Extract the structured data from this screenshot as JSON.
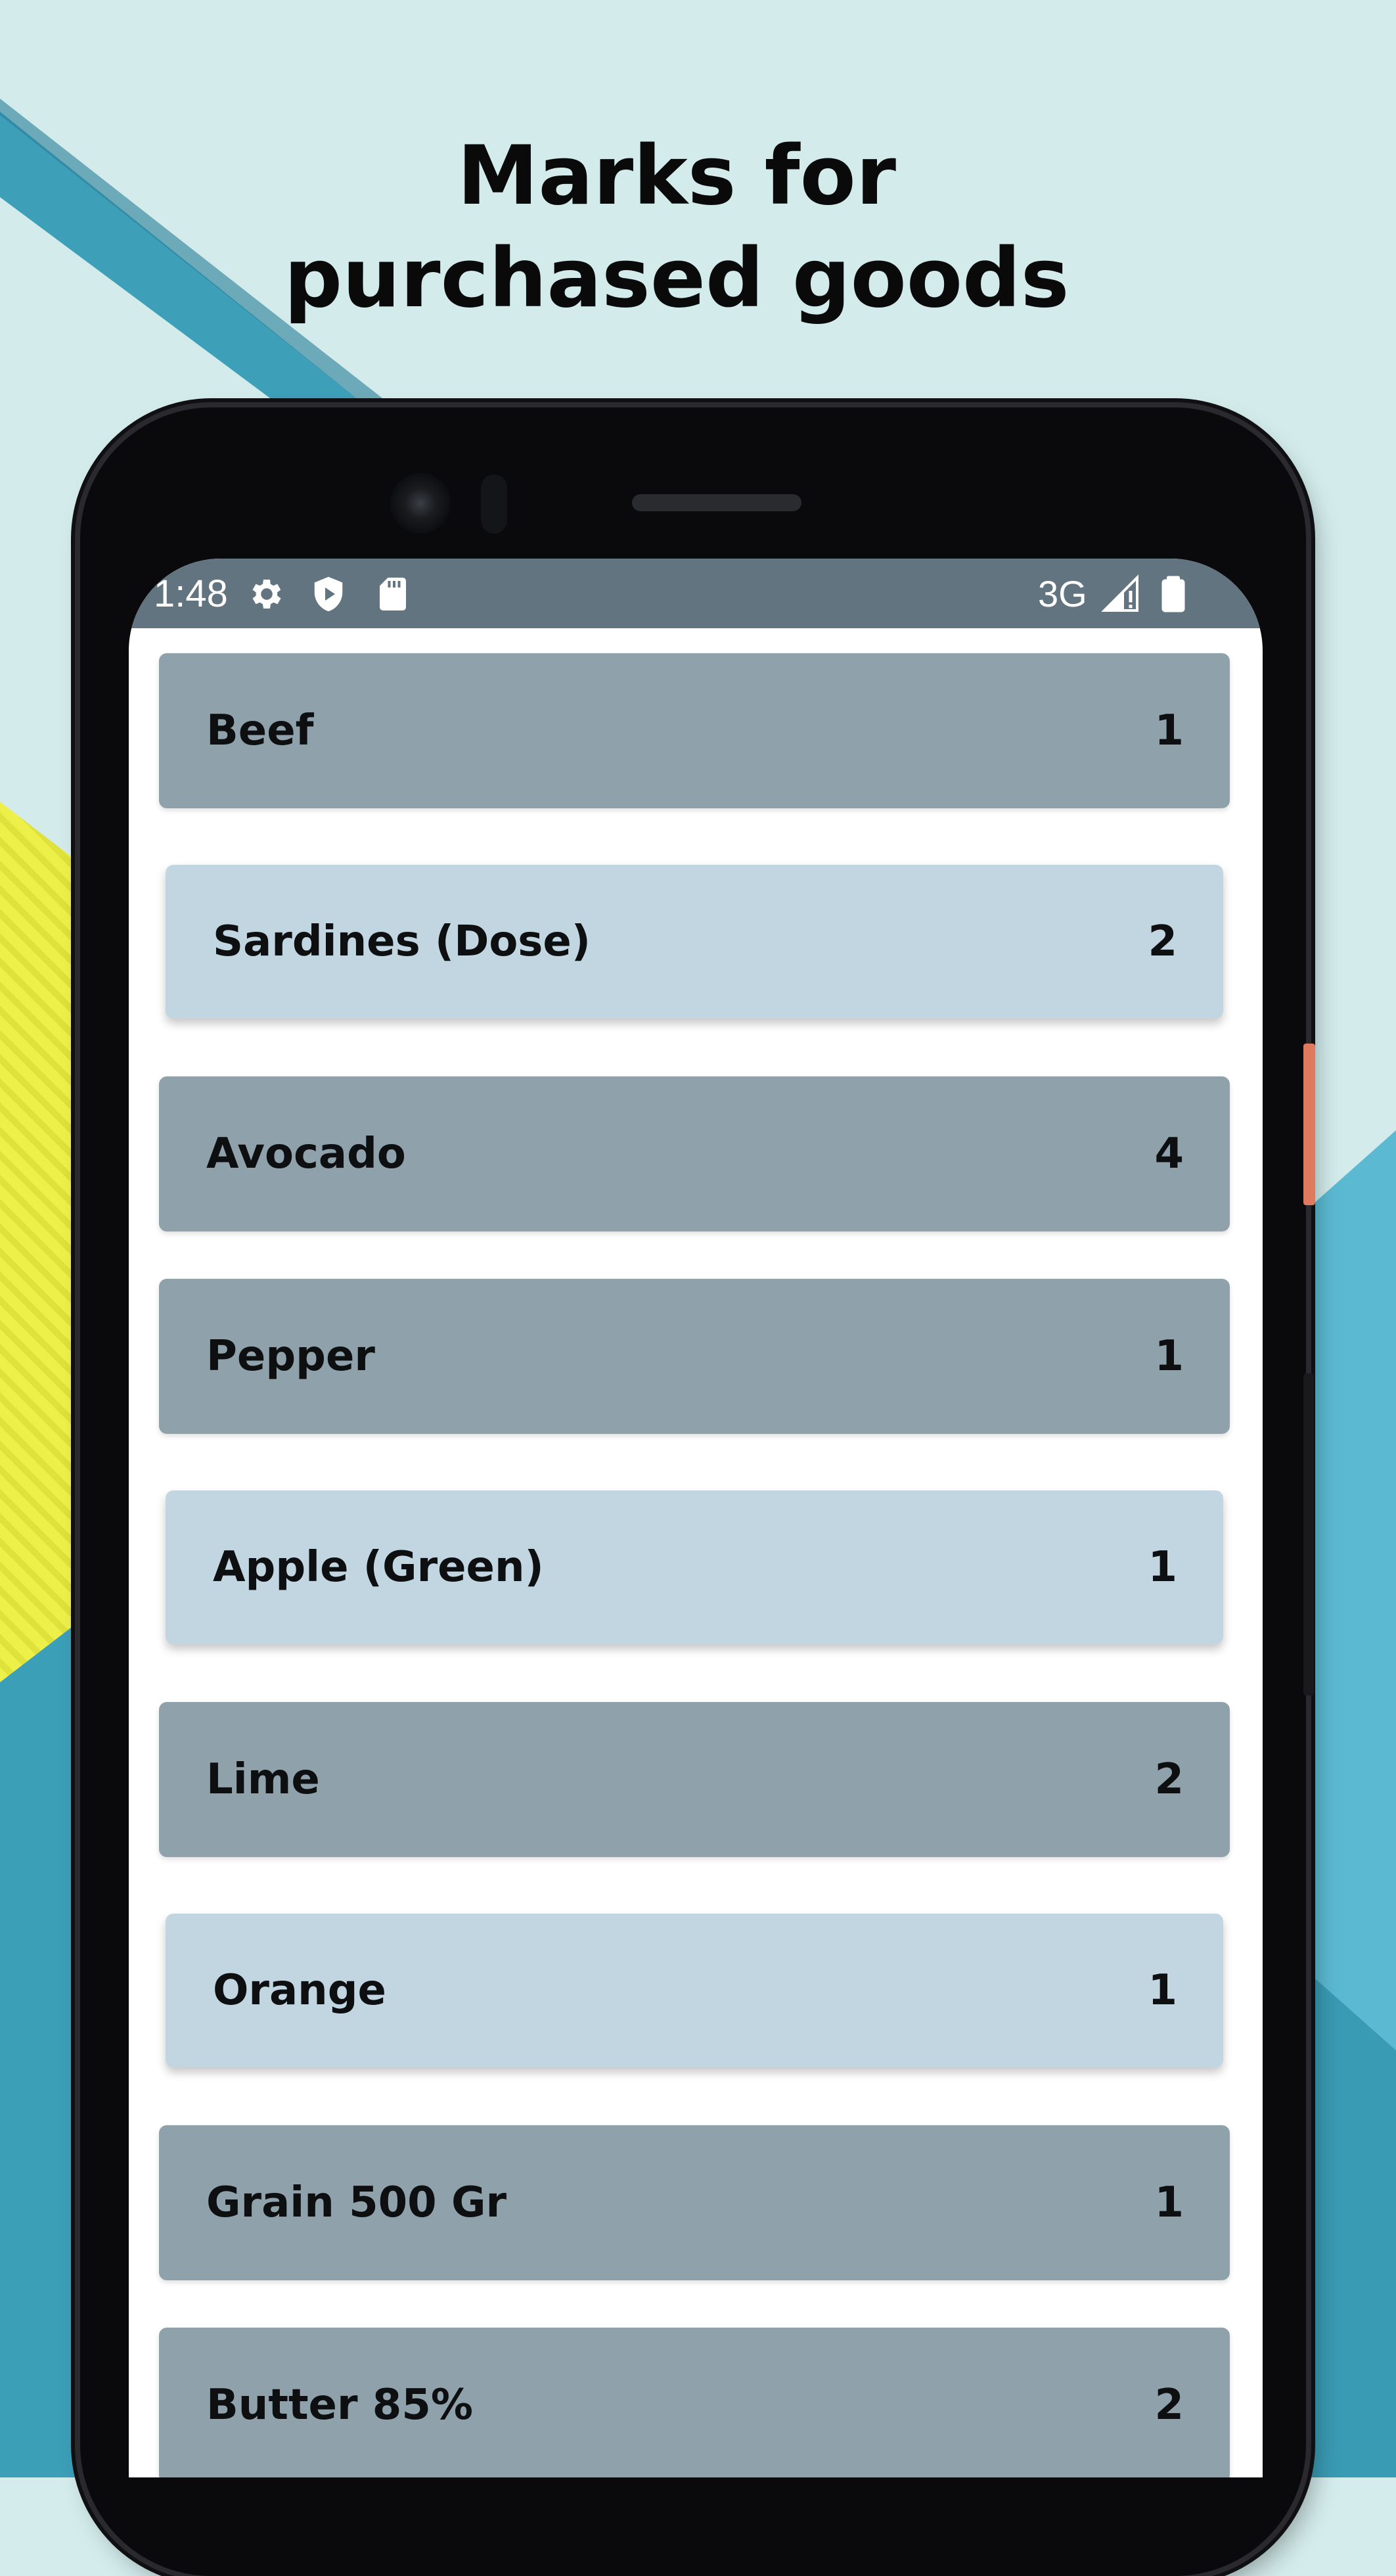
{
  "headline": {
    "line1": "Marks for",
    "line2": "purchased goods"
  },
  "status_bar": {
    "time": "1:48",
    "network": "3G",
    "icons": [
      "gear-icon",
      "shield-play-icon",
      "sd-card-icon",
      "signal-icon",
      "battery-icon"
    ]
  },
  "colors": {
    "status_bar": "#617480",
    "item_dark": "#8fa2ab",
    "item_light": "#c1d6e0"
  },
  "items": [
    {
      "name": "Beef",
      "count": "1",
      "style": "dark"
    },
    {
      "name": "Sardines (Dose)",
      "count": "2",
      "style": "light"
    },
    {
      "name": "Avocado",
      "count": "4",
      "style": "dark"
    },
    {
      "name": "Pepper",
      "count": "1",
      "style": "dark"
    },
    {
      "name": "Apple (Green)",
      "count": "1",
      "style": "light"
    },
    {
      "name": "Lime",
      "count": "2",
      "style": "dark"
    },
    {
      "name": "Orange",
      "count": "1",
      "style": "light"
    },
    {
      "name": "Grain 500 Gr",
      "count": "1",
      "style": "dark"
    },
    {
      "name": "Butter 85%",
      "count": "2",
      "style": "dark"
    }
  ]
}
